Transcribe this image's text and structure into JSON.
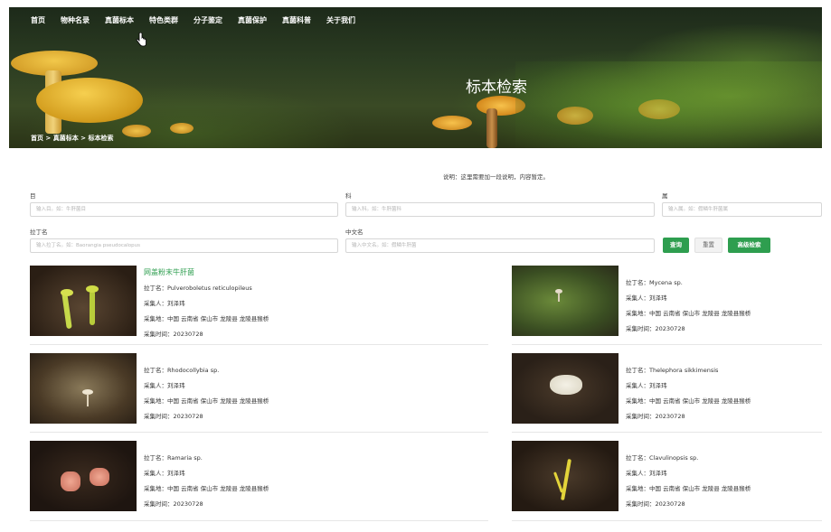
{
  "nav": {
    "items": [
      "首页",
      "物种名录",
      "真菌标本",
      "特色类群",
      "分子鉴定",
      "真菌保护",
      "真菌科普",
      "关于我们"
    ]
  },
  "banner": {
    "title": "标本检索",
    "breadcrumb": "首页 > 真菌标本 > 标本检索"
  },
  "description": "说明：这里需要加一段说明，内容暂定。",
  "search": {
    "genus_label": "目",
    "genus_placeholder": "输入目。如：牛肝菌目",
    "family_label": "科",
    "family_placeholder": "输入科。如：牛肝菌科",
    "species_label": "属",
    "species_placeholder": "输入属。如：假鳞牛肝菌属",
    "latin_label": "拉丁名",
    "latin_placeholder": "输入拉丁名。如：Baorangia pseudocalopus",
    "chinese_label": "中文名",
    "chinese_placeholder": "输入中文名。如：假鳞牛肝菌",
    "search_button": "查询",
    "reset_button": "重置",
    "advanced_button": "高级检索"
  },
  "specimens": [
    {
      "name": "网盖粉末牛肝菌",
      "latin": "拉丁名：Pulveroboletus reticulopileus",
      "collector": "采集人：刘泽玮",
      "location": "采集地：中国 云南省 保山市 龙陵县 龙陵县猴桥",
      "date": "采集时间：20230728"
    },
    {
      "name": "",
      "latin": "拉丁名：Mycena sp.",
      "collector": "采集人：刘泽玮",
      "location": "采集地：中国 云南省 保山市 龙陵县 龙陵县猴桥",
      "date": "采集时间：20230728"
    },
    {
      "name": "",
      "latin": "拉丁名：Rhodocollybia sp.",
      "collector": "采集人：刘泽玮",
      "location": "采集地：中国 云南省 保山市 龙陵县 龙陵县猴桥",
      "date": "采集时间：20230728"
    },
    {
      "name": "",
      "latin": "拉丁名：Thelephora sikkimensis",
      "collector": "采集人：刘泽玮",
      "location": "采集地：中国 云南省 保山市 龙陵县 龙陵县猴桥",
      "date": "采集时间：20230728"
    },
    {
      "name": "",
      "latin": "拉丁名：Ramaria sp.",
      "collector": "采集人：刘泽玮",
      "location": "采集地：中国 云南省 保山市 龙陵县 龙陵县猴桥",
      "date": "采集时间：20230728"
    },
    {
      "name": "",
      "latin": "拉丁名：Clavulinopsis sp.",
      "collector": "采集人：刘泽玮",
      "location": "采集地：中国 云南省 保山市 龙陵县 龙陵县猴桥",
      "date": "采集时间：20230728"
    }
  ],
  "colors": {
    "accent": "#2e9e4f"
  }
}
